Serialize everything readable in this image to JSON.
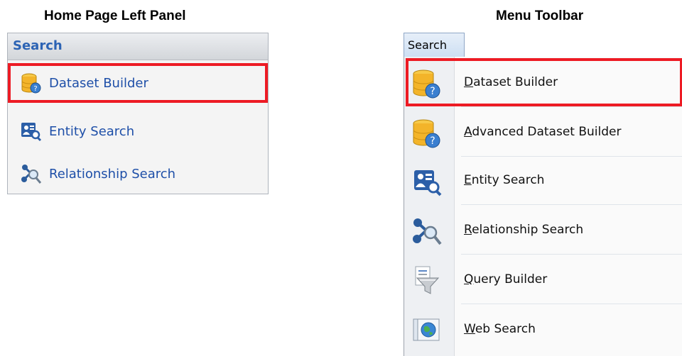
{
  "left_panel": {
    "title": "Home Page Left Panel",
    "header": "Search",
    "items": [
      {
        "label": "Dataset Builder",
        "icon": "database-help-icon",
        "highlighted": true
      },
      {
        "label": "Entity Search",
        "icon": "entity-search-icon",
        "highlighted": false
      },
      {
        "label": "Relationship Search",
        "icon": "relationship-search-icon",
        "highlighted": false
      }
    ]
  },
  "right_panel": {
    "title": "Menu Toolbar",
    "tab": "Search",
    "items": [
      {
        "label": "Dataset Builder",
        "mnemonic": "D",
        "rest": "ataset Builder",
        "icon": "database-help-icon",
        "highlighted": true
      },
      {
        "label": "Advanced Dataset Builder",
        "mnemonic": "A",
        "rest": "dvanced Dataset Builder",
        "icon": "database-help-icon",
        "highlighted": false
      },
      {
        "label": "Entity Search",
        "mnemonic": "E",
        "rest": "ntity Search",
        "icon": "entity-search-icon",
        "highlighted": false
      },
      {
        "label": "Relationship Search",
        "mnemonic": "R",
        "rest": "elationship Search",
        "icon": "relationship-search-icon",
        "highlighted": false
      },
      {
        "label": "Query Builder",
        "mnemonic": "Q",
        "rest": "uery Builder",
        "icon": "funnel-icon",
        "highlighted": false
      },
      {
        "label": "Web Search",
        "mnemonic": "W",
        "rest": "eb Search",
        "icon": "globe-icon",
        "highlighted": false
      }
    ]
  },
  "colors": {
    "highlight": "#ed1b24",
    "link_text": "#1e4fa8",
    "header_text": "#2c63b4"
  }
}
